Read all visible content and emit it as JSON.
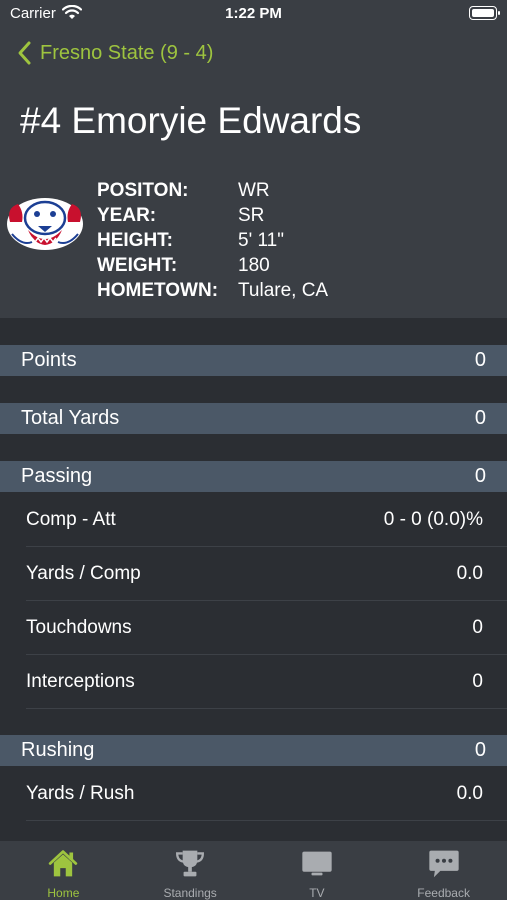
{
  "status_bar": {
    "carrier": "Carrier",
    "time": "1:22 PM"
  },
  "nav": {
    "back_label": "Fresno State (9 - 4)"
  },
  "player": {
    "title": "#4 Emoryie Edwards",
    "labels": [
      "POSITON:",
      "YEAR:",
      "HEIGHT:",
      "WEIGHT:",
      "HOMETOWN:"
    ],
    "values": [
      "WR",
      "SR",
      "5' 11\"",
      "180",
      "Tulare, CA"
    ]
  },
  "sections": {
    "points": {
      "title": "Points",
      "value": "0"
    },
    "total_yards": {
      "title": "Total Yards",
      "value": "0"
    },
    "passing": {
      "title": "Passing",
      "value": "0",
      "rows": [
        {
          "label": "Comp - Att",
          "value": "0 - 0 (0.0)%"
        },
        {
          "label": "Yards / Comp",
          "value": "0.0"
        },
        {
          "label": "Touchdowns",
          "value": "0"
        },
        {
          "label": "Interceptions",
          "value": "0"
        }
      ]
    },
    "rushing": {
      "title": "Rushing",
      "value": "0",
      "rows": [
        {
          "label": "Yards / Rush",
          "value": "0.0"
        }
      ]
    }
  },
  "tabs": [
    {
      "label": "Home",
      "icon": "home-icon",
      "active": true
    },
    {
      "label": "Standings",
      "icon": "trophy-icon",
      "active": false
    },
    {
      "label": "TV",
      "icon": "tv-icon",
      "active": false
    },
    {
      "label": "Feedback",
      "icon": "chat-icon",
      "active": false
    }
  ],
  "colors": {
    "accent": "#9ec43f",
    "section_bg": "#4b5867",
    "background": "#2b2e33",
    "header_bg": "#3a3e44"
  }
}
